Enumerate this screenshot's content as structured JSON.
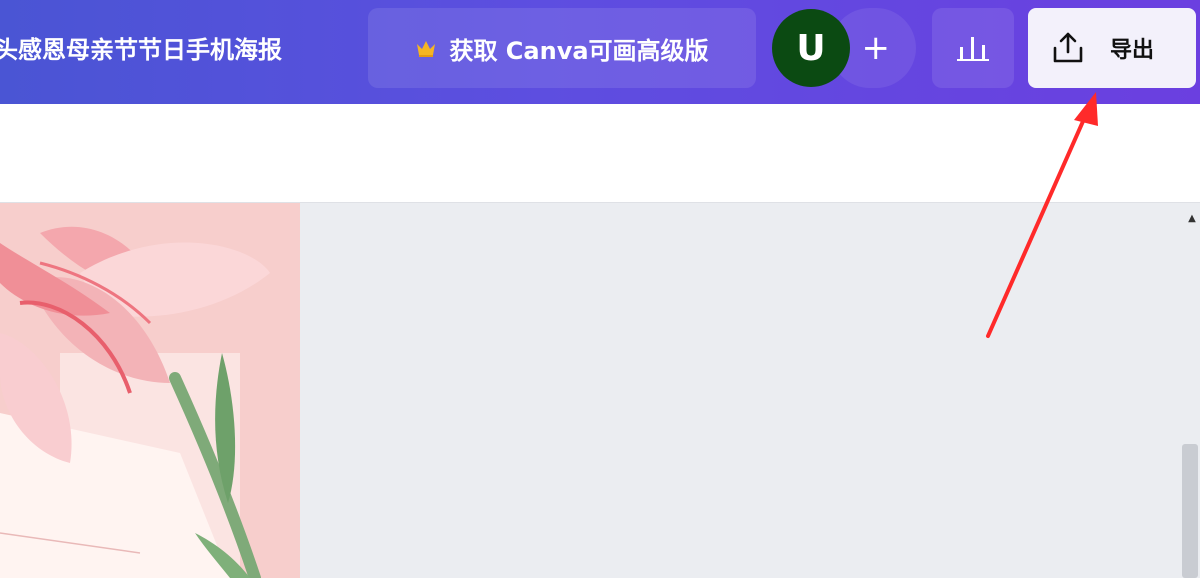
{
  "header": {
    "doc_title": "头感恩母亲节节日手机海报",
    "upgrade_label": "获取 Canva可画高级版",
    "upgrade_icon": "crown-icon",
    "avatar_letter": "U",
    "add_label": "+",
    "stats_icon": "bar-chart-icon",
    "export_label": "导出",
    "export_icon": "share-upload-icon"
  },
  "workspace": {
    "scrollbar_up_glyph": "▲"
  },
  "colors": {
    "header_start": "#4a55d4",
    "header_end": "#6b3fe0",
    "avatar_bg": "#0b4a12",
    "export_bg": "#f3f1fb",
    "annotation_arrow": "#ff2a2a"
  }
}
